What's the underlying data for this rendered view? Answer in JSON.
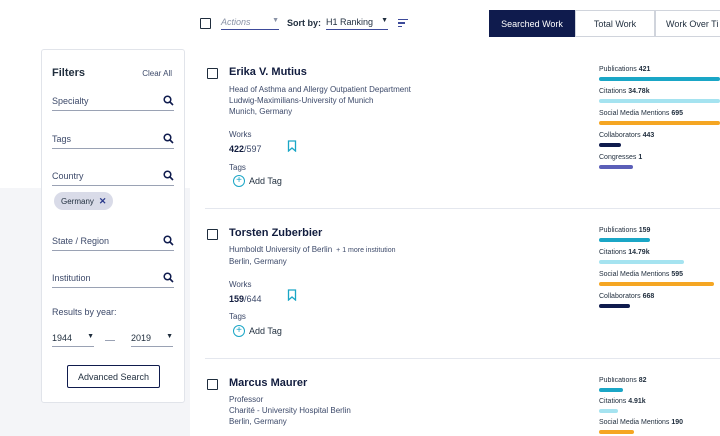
{
  "toolbar": {
    "actions_placeholder": "Actions",
    "sort_label": "Sort by:",
    "sort_value": "H1 Ranking"
  },
  "tabs": [
    "Searched Work",
    "Total Work",
    "Work Over Ti"
  ],
  "filters": {
    "title": "Filters",
    "clear_all": "Clear All",
    "specialty": "Specialty",
    "tags": "Tags",
    "country": "Country",
    "country_chip": "Germany",
    "state": "State / Region",
    "institution": "Institution",
    "results_by_year": "Results by year:",
    "year_from": "1944",
    "year_to": "2019",
    "advanced_search": "Advanced Search"
  },
  "results": [
    {
      "name": "Erika V. Mutius",
      "lines": [
        "Head of Asthma and Allergy Outpatient Department",
        "Ludwig-Maximilians-University of Munich",
        "Munich, Germany"
      ],
      "works_label": "Works",
      "works_value": "422",
      "works_total": "/597",
      "tags_label": "Tags",
      "add_tag": "Add Tag",
      "metrics": [
        {
          "label": "Publications",
          "value": "421",
          "fraction": 1.0,
          "color": "#1aa6c6"
        },
        {
          "label": "Citations",
          "value": "34.78k",
          "fraction": 1.0,
          "color": "#a5e3f0"
        },
        {
          "label": "Social Media Mentions",
          "value": "695",
          "fraction": 1.0,
          "color": "#f5a623"
        },
        {
          "label": "Collaborators",
          "value": "443",
          "fraction": 0.18,
          "color": "#0f1b4d"
        },
        {
          "label": "Congresses",
          "value": "1",
          "fraction": 0.28,
          "color": "#5b5fb8"
        }
      ]
    },
    {
      "name": "Torsten Zuberbier",
      "lines": [
        "Humboldt University of Berlin",
        "Berlin, Germany"
      ],
      "more_inst": "+ 1 more institution",
      "works_label": "Works",
      "works_value": "159",
      "works_total": "/644",
      "tags_label": "Tags",
      "add_tag": "Add Tag",
      "metrics": [
        {
          "label": "Publications",
          "value": "159",
          "fraction": 0.42,
          "color": "#1aa6c6"
        },
        {
          "label": "Citations",
          "value": "14.79k",
          "fraction": 0.7,
          "color": "#a5e3f0"
        },
        {
          "label": "Social Media Mentions",
          "value": "595",
          "fraction": 0.95,
          "color": "#f5a623"
        },
        {
          "label": "Collaborators",
          "value": "668",
          "fraction": 0.26,
          "color": "#0f1b4d"
        }
      ]
    },
    {
      "name": "Marcus Maurer",
      "lines": [
        "Professor",
        "Charité - University Hospital Berlin",
        "Berlin, Germany"
      ],
      "metrics": [
        {
          "label": "Publications",
          "value": "82",
          "fraction": 0.2,
          "color": "#1aa6c6"
        },
        {
          "label": "Citations",
          "value": "4.91k",
          "fraction": 0.16,
          "color": "#a5e3f0"
        },
        {
          "label": "Social Media Mentions",
          "value": "190",
          "fraction": 0.29,
          "color": "#f5a623"
        }
      ]
    }
  ]
}
